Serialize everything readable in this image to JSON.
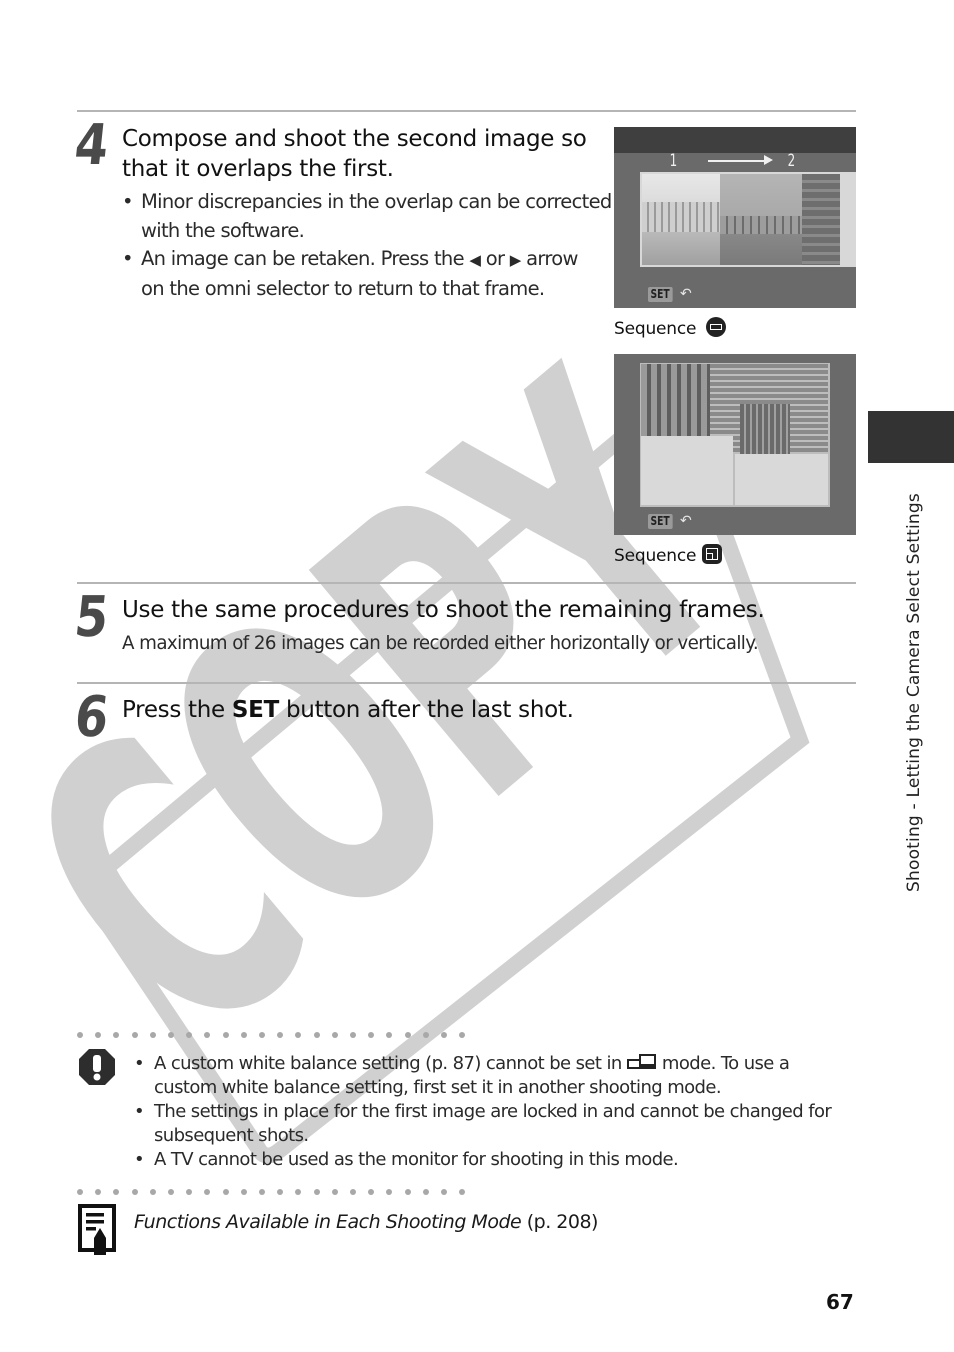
{
  "page": {
    "number": "67",
    "watermark": "COPY",
    "side_tab_label": "Shooting - Letting the Camera Select Settings"
  },
  "steps": [
    {
      "number": "4",
      "title_line1": "Compose and shoot the second image so",
      "title_line2": "that it overlaps the first.",
      "bullets": [
        {
          "line1": "Minor discrepancies in the overlap can be corrected",
          "line2": "with the software."
        },
        {
          "line1_pre": "An image can be retaken. Press the ",
          "left_arrow": "◀",
          "mid": " or ",
          "right_arrow": "▶",
          "line1_post": " arrow",
          "line2": "on the omni selector to return to that frame."
        }
      ]
    },
    {
      "number": "5",
      "title": "Use the same procedures to shoot the remaining frames.",
      "body": "A maximum of 26 images can be recorded either horizontally or vertically."
    },
    {
      "number": "6",
      "title_pre": "Press the ",
      "title_bold": "SET",
      "title_post": " button after the last shot."
    }
  ],
  "figures": [
    {
      "caption": "Sequence",
      "icon": "horizontal-sequence-icon",
      "screen_label_from": "1",
      "screen_label_to": "2",
      "set_label": "SET",
      "back_icon": "↶"
    },
    {
      "caption": "Sequence",
      "icon": "clockwise-sequence-icon",
      "set_label": "SET",
      "back_icon": "↶"
    }
  ],
  "caution": {
    "icon": "caution-icon",
    "items": [
      {
        "line1_pre": "A custom white balance setting (p. 87) cannot be set in ",
        "mode_icon": "stitch-assist-icon",
        "line1_post": " mode. To use a",
        "line2": "custom white balance setting, first set it in another shooting mode."
      },
      {
        "line1": "The settings in place for the first image are locked in and cannot be changed for",
        "line2": "subsequent shots."
      },
      {
        "line1": "A TV cannot be used as the monitor for shooting in this mode."
      }
    ]
  },
  "reference": {
    "icon": "reference-memo-icon",
    "title": "Functions Available in Each Shooting Mode",
    "page_ref": " (p. 208)"
  }
}
